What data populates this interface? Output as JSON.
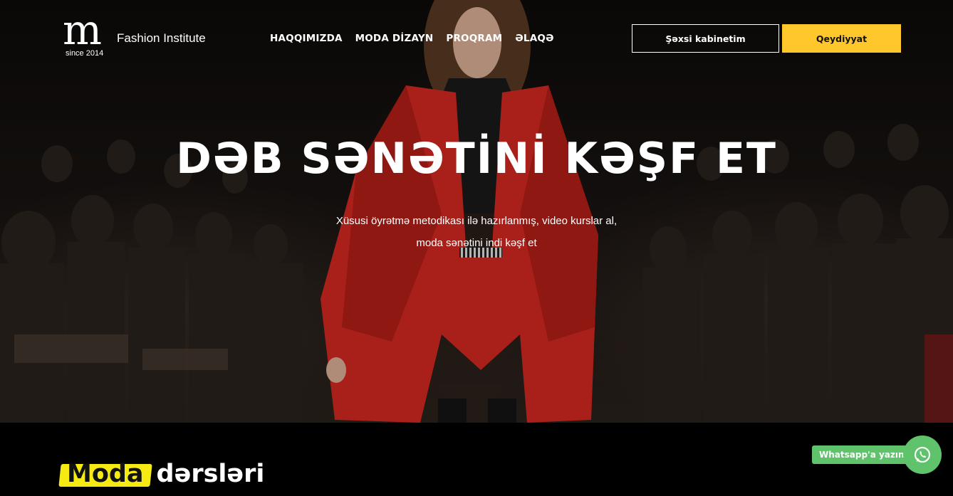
{
  "header": {
    "logo_letter": "m",
    "logo_since": "since 2014",
    "logo_name": "Fashion Institute",
    "nav": [
      "HAQQIMIZDA",
      "MODA DİZAYN",
      "PROQRAM",
      "ƏLAQƏ"
    ],
    "cabinet_button": "Şəxsi kabinetim",
    "register_button": "Qeydiyyat"
  },
  "hero": {
    "title": "DƏB SƏNƏTİNİ KƏŞF ET",
    "subtitle_line1": "Xüsusi öyrətmə metodikası ilə hazırlanmış, video kurslar al,",
    "subtitle_line2": "moda sənətini indi kəşf et"
  },
  "section": {
    "heading_highlight": "Moda",
    "heading_rest": "dərsləri"
  },
  "whatsapp": {
    "label": "Whatsapp'a yazın",
    "icon": "whatsapp-icon"
  },
  "colors": {
    "accent_yellow": "#fec72b",
    "highlight_yellow": "#f5ea12",
    "whatsapp_green": "#5ec36a",
    "coat_red": "#d92a22"
  }
}
